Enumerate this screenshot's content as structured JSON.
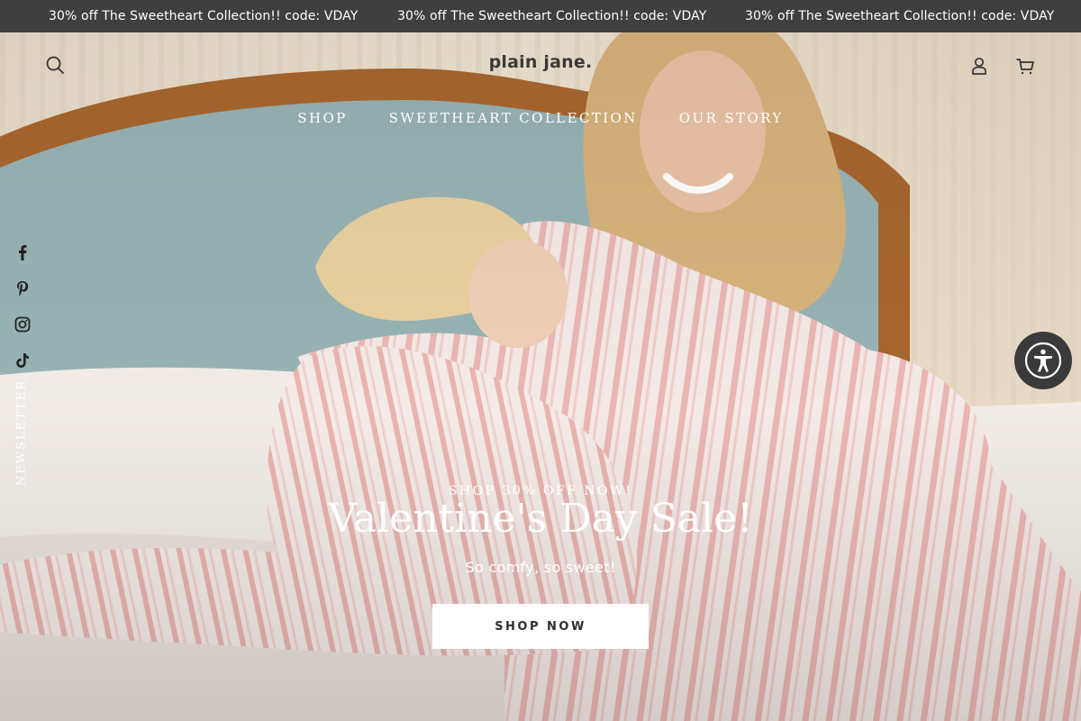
{
  "announcement": {
    "messages": [
      "30% off The Sweetheart Collection!! code: VDAY",
      "30% off The Sweetheart Collection!! code: VDAY",
      "30% off The Sweetheart Collection!! code: VDAY"
    ]
  },
  "header": {
    "logo": "plain jane.",
    "icons": {
      "search": "search-icon",
      "account": "user-icon",
      "cart": "cart-icon"
    }
  },
  "nav": {
    "items": [
      {
        "label": "SHOP"
      },
      {
        "label": "SWEETHEART COLLECTION"
      },
      {
        "label": "OUR STORY"
      }
    ]
  },
  "social": {
    "icons": [
      "facebook-icon",
      "pinterest-icon",
      "instagram-icon",
      "tiktok-icon"
    ],
    "newsletter_label": "NEWSLETTER"
  },
  "hero": {
    "eyebrow": "SHOP 30% OFF NOW!",
    "headline": "Valentine's Day Sale!",
    "subtext": "So comfy, so sweet!",
    "cta_label": "SHOP NOW"
  },
  "accessibility": {
    "icon": "accessibility-icon"
  },
  "colors": {
    "announcement_bg": "#3f3f3f",
    "text_light": "#ffffff",
    "cta_bg": "#ffffff",
    "accessibility_bg": "#3a3a3a"
  }
}
